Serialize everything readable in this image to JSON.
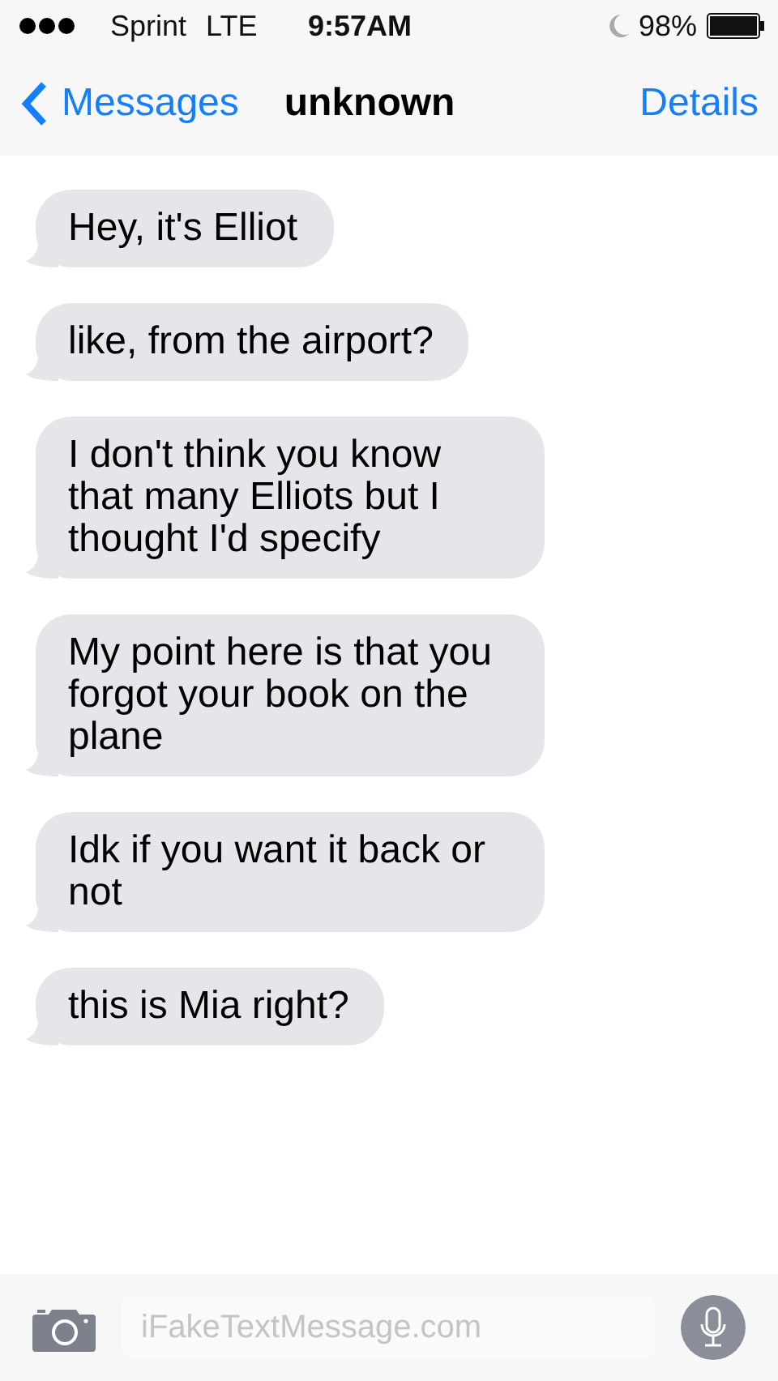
{
  "status_bar": {
    "carrier": "Sprint",
    "network": "LTE",
    "time": "9:57AM",
    "battery": "98%"
  },
  "nav_bar": {
    "back": "Messages",
    "title": "unknown",
    "action": "Details"
  },
  "messages": [
    {
      "text": "Hey, it's Elliot"
    },
    {
      "text": "like, from the airport?"
    },
    {
      "text": "I don't think you know that many Elliots but I thought I'd specify"
    },
    {
      "text": "My point here is that you forgot your book on the plane"
    },
    {
      "text": "Idk if you want it back or not"
    },
    {
      "text": "this is Mia right?"
    }
  ],
  "composer": {
    "placeholder": "iFakeTextMessage.com"
  }
}
